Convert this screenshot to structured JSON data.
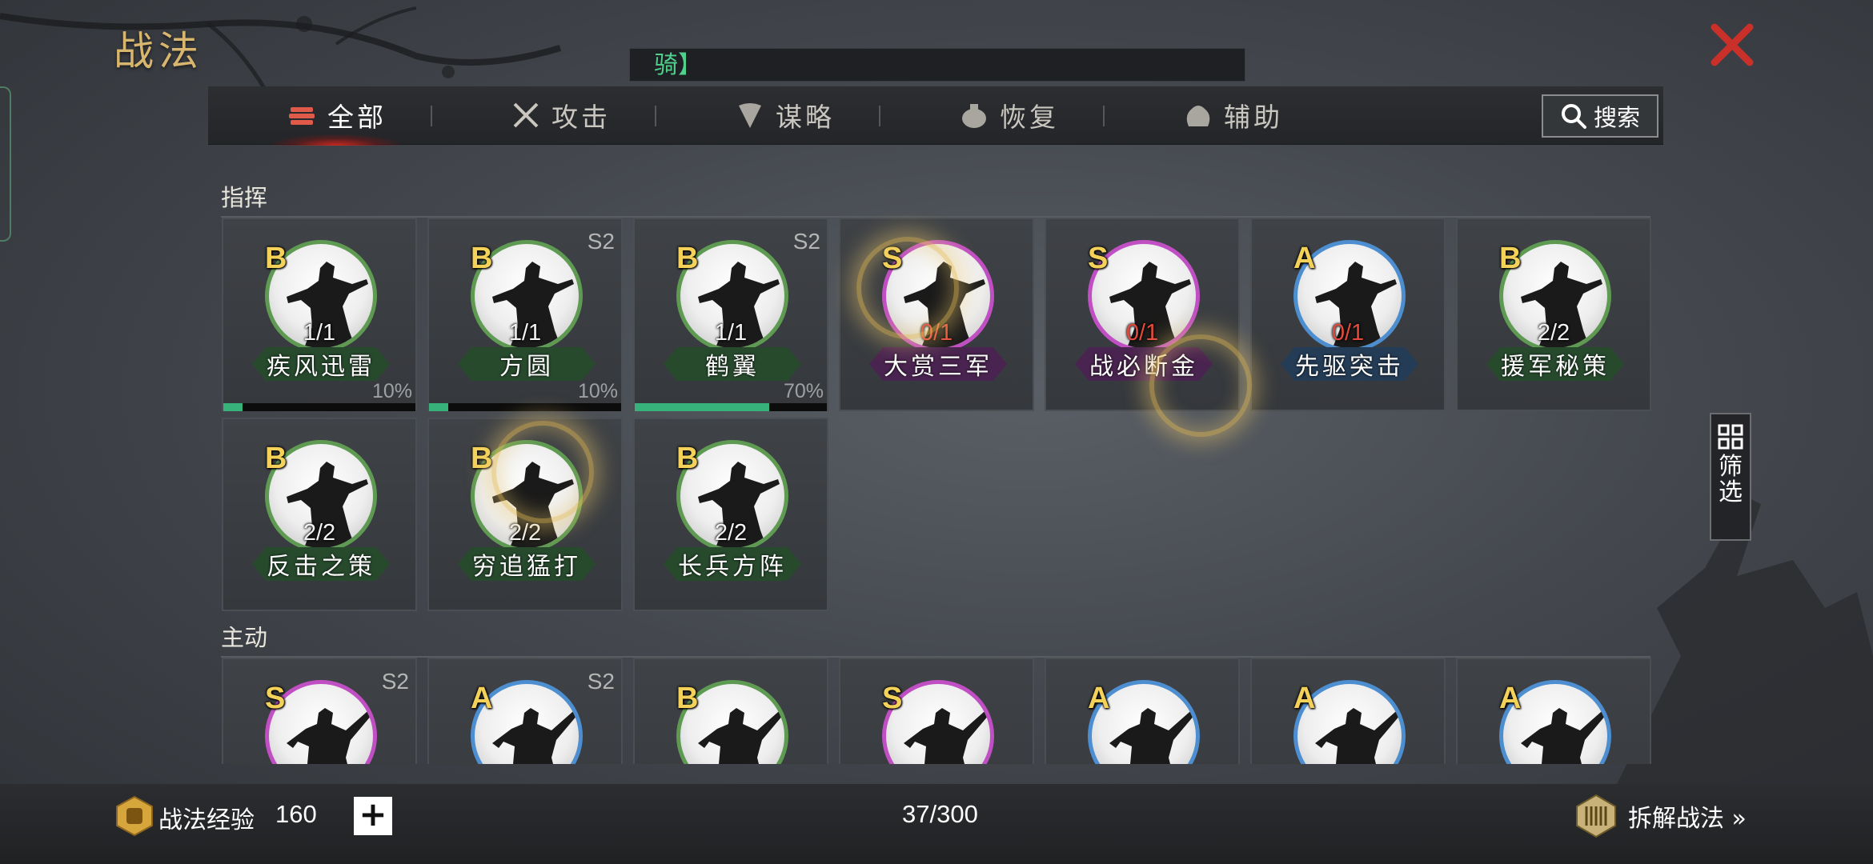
{
  "header": {
    "title": "战法",
    "filter_text": "骑】"
  },
  "tabs": [
    {
      "label": "全部",
      "icon": "scroll-bundle-icon",
      "active": true
    },
    {
      "label": "攻击",
      "icon": "crossed-swords-icon",
      "active": false
    },
    {
      "label": "谋略",
      "icon": "feather-fan-icon",
      "active": false
    },
    {
      "label": "恢复",
      "icon": "medicine-pouch-icon",
      "active": false
    },
    {
      "label": "辅助",
      "icon": "money-bag-icon",
      "active": false
    }
  ],
  "search": {
    "label": "搜索"
  },
  "sections": [
    {
      "title": "指挥"
    },
    {
      "title": "主动"
    }
  ],
  "command_cards": [
    {
      "grade": "B",
      "season": "",
      "count": "1/1",
      "name": "疾风迅雷",
      "xp": "10%",
      "xp_value": 10,
      "ring": "#5e9a52",
      "plate": "#274a2d"
    },
    {
      "grade": "B",
      "season": "S2",
      "count": "1/1",
      "name": "方圆",
      "xp": "10%",
      "xp_value": 10,
      "ring": "#5e9a52",
      "plate": "#274a2d"
    },
    {
      "grade": "B",
      "season": "S2",
      "count": "1/1",
      "name": "鹤翼",
      "xp": "70%",
      "xp_value": 70,
      "ring": "#5e9a52",
      "plate": "#274a2d"
    },
    {
      "grade": "S",
      "season": "",
      "count": "0/1",
      "name": "大赏三军",
      "xp": "",
      "xp_value": null,
      "ring": "#c14fc4",
      "plate": "#4a2450"
    },
    {
      "grade": "S",
      "season": "",
      "count": "0/1",
      "name": "战必断金",
      "xp": "",
      "xp_value": null,
      "ring": "#c14fc4",
      "plate": "#4a2450"
    },
    {
      "grade": "A",
      "season": "",
      "count": "0/1",
      "name": "先驱突击",
      "xp": "",
      "xp_value": null,
      "ring": "#4c8ed0",
      "plate": "#243c56"
    },
    {
      "grade": "B",
      "season": "",
      "count": "2/2",
      "name": "援军秘策",
      "xp": "",
      "xp_value": null,
      "ring": "#5e9a52",
      "plate": "#274a2d"
    },
    {
      "grade": "B",
      "season": "",
      "count": "2/2",
      "name": "反击之策",
      "xp": "",
      "xp_value": null,
      "ring": "#5e9a52",
      "plate": "#274a2d"
    },
    {
      "grade": "B",
      "season": "",
      "count": "2/2",
      "name": "穷追猛打",
      "xp": "",
      "xp_value": null,
      "ring": "#5e9a52",
      "plate": "#274a2d"
    },
    {
      "grade": "B",
      "season": "",
      "count": "2/2",
      "name": "长兵方阵",
      "xp": "",
      "xp_value": null,
      "ring": "#5e9a52",
      "plate": "#274a2d"
    }
  ],
  "active_cards": [
    {
      "grade": "S",
      "season": "S2",
      "ring": "#c14fc4"
    },
    {
      "grade": "A",
      "season": "S2",
      "ring": "#4c8ed0"
    },
    {
      "grade": "B",
      "season": "",
      "ring": "#5e9a52"
    },
    {
      "grade": "S",
      "season": "",
      "ring": "#c14fc4"
    },
    {
      "grade": "A",
      "season": "",
      "ring": "#4c8ed0"
    },
    {
      "grade": "A",
      "season": "",
      "ring": "#4c8ed0"
    },
    {
      "grade": "A",
      "season": "",
      "ring": "#4c8ed0"
    }
  ],
  "side_filter": {
    "label": "筛选"
  },
  "footer": {
    "exp_label": "战法经验",
    "exp_value": "160",
    "plus": "+",
    "count": "37/300",
    "dismantle_label": "拆解战法 »"
  }
}
